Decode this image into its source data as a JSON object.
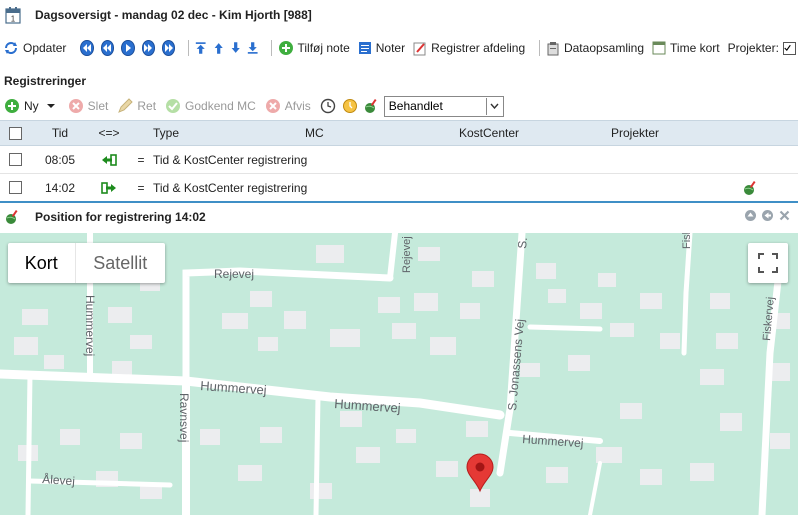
{
  "window": {
    "title": "Dagsoversigt - mandag 02 dec - Kim Hjorth [988]"
  },
  "toolbar": {
    "refresh_label": "Opdater",
    "add_note_label": "Tilføj note",
    "notes_label": "Noter",
    "register_dept_label": "Registrer afdeling",
    "data_collection_label": "Dataopsamling",
    "timecard_label": "Time kort",
    "projects_label": "Projekter:",
    "projects_checked": true
  },
  "registrations": {
    "title": "Registreringer",
    "actions": {
      "new": "Ny",
      "delete": "Slet",
      "edit": "Ret",
      "approve": "Godkend MC",
      "reject": "Afvis"
    },
    "status_select": {
      "value": "Behandlet"
    },
    "columns": {
      "time": "Tid",
      "direction": "<=>",
      "type": "Type",
      "mc": "MC",
      "costcenter": "KostCenter",
      "projects": "Projekter"
    },
    "rows": [
      {
        "time": "08:05",
        "dir_icon": "arrow-in-icon",
        "eq": "=",
        "type": "Tid & KostCenter registrering",
        "has_position": false
      },
      {
        "time": "14:02",
        "dir_icon": "arrow-out-icon",
        "eq": "=",
        "type": "Tid & KostCenter registrering",
        "has_position": true
      }
    ]
  },
  "position_panel": {
    "title": "Position for registrering 14:02",
    "map": {
      "type_kort": "Kort",
      "type_satellit": "Satellit",
      "streets": {
        "rejevej_h": "Rejevej",
        "rejevej_v": "Rejevej",
        "hummervej_v": "Hummervej",
        "hummervej_main": "Hummervej",
        "hummervej_mid": "Hummervej",
        "hummervej_right": "Hummervej",
        "ravnsvej": "Ravnsvej",
        "alevej": "Ålevej",
        "sjonassens": "S. Jonassens Vej",
        "s_top": "S.",
        "fiskervej": "Fiskervej",
        "fisk_top": "Fisk"
      },
      "colors": {
        "land": "#c5eadb",
        "road": "#ffffff",
        "building": "#ecedef",
        "marker": "#e53935"
      }
    }
  }
}
